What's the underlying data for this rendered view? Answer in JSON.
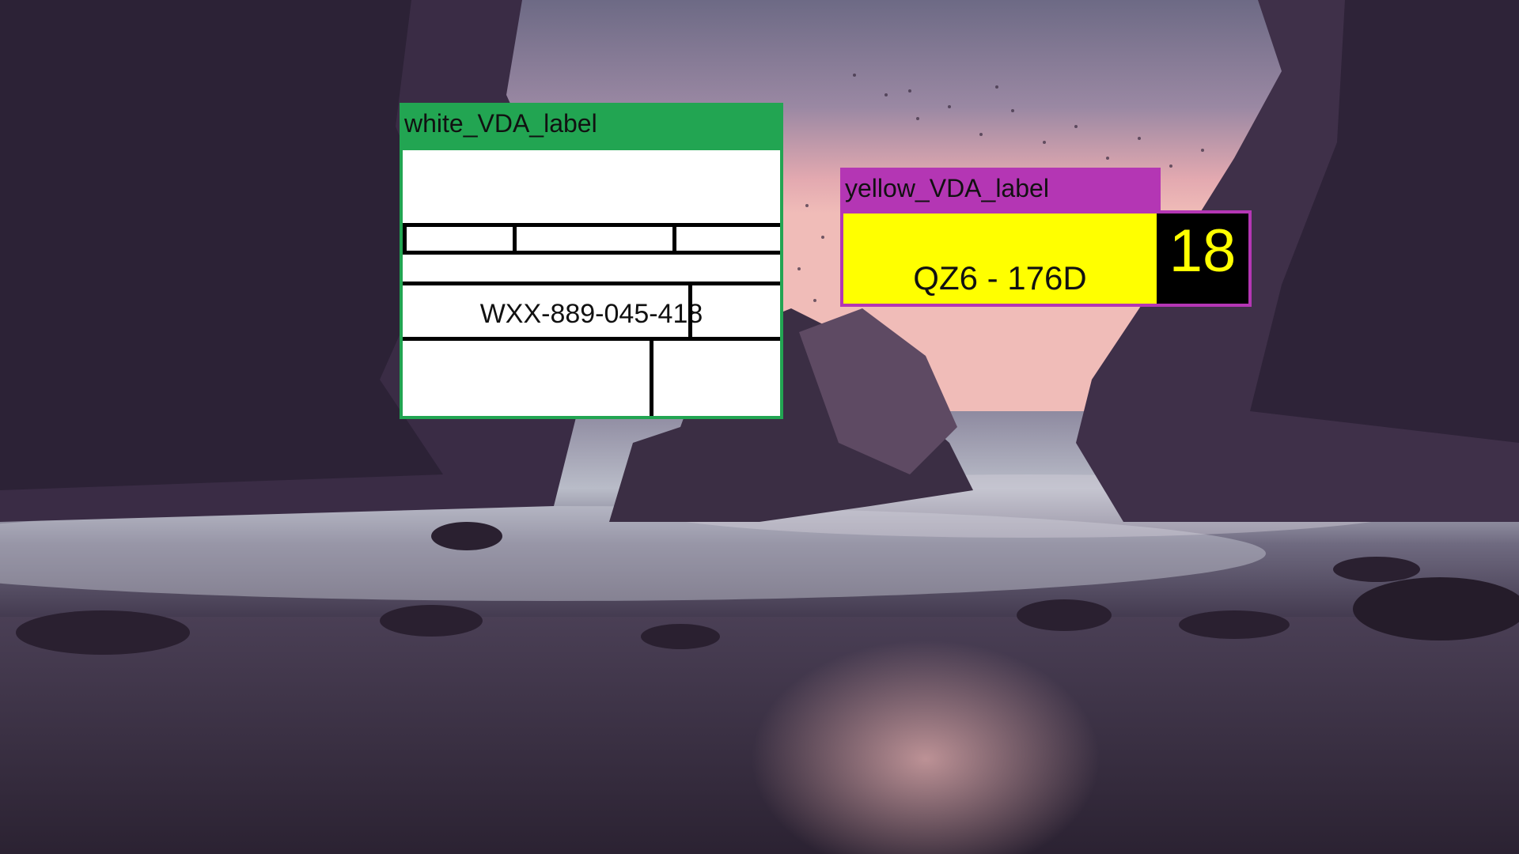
{
  "annotations": {
    "white": {
      "tag": "white_VDA_label",
      "color": "#22a552",
      "label": {
        "code": "WXX-889-045-418"
      }
    },
    "yellow": {
      "tag": "yellow_VDA_label",
      "color": "#b436b4",
      "label": {
        "code": "QZ6 - 176D",
        "number": "18"
      }
    }
  }
}
